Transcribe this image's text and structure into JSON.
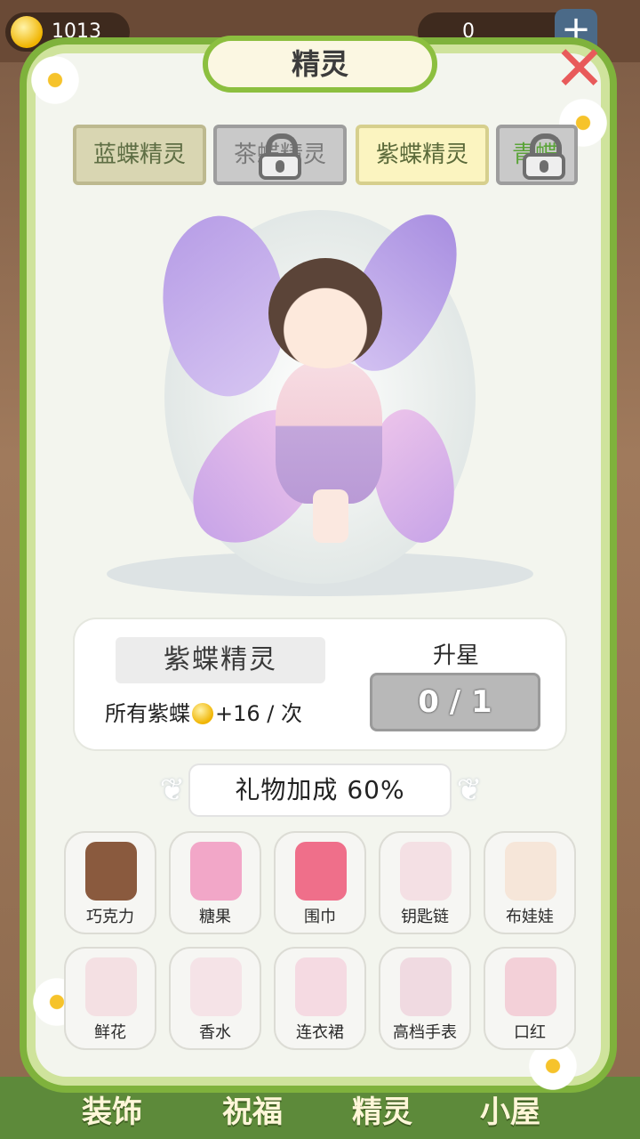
{
  "hud": {
    "currency_left": "1013",
    "currency_right": "0",
    "plus_label": "+"
  },
  "panel": {
    "title": "精灵",
    "close_label": "✕"
  },
  "tabs": [
    {
      "label": "蓝蝶精灵",
      "locked": false
    },
    {
      "label": "茶蝶精灵",
      "locked": true
    },
    {
      "label": "紫蝶精灵",
      "locked": false,
      "selected": true
    },
    {
      "label": "青蝶精灵",
      "locked": true
    }
  ],
  "info": {
    "name": "紫蝶精灵",
    "bonus_prefix": "所有紫蝶",
    "bonus_suffix": "+16 / 次",
    "upgrade_label": "升星",
    "upgrade_progress": "0 / 1"
  },
  "gift_bonus": "礼物加成 60%",
  "gifts": [
    {
      "label": "巧克力",
      "icon": "chocolate-icon",
      "owned": true,
      "color": "#8a5a3e"
    },
    {
      "label": "糖果",
      "icon": "candy-jar-icon",
      "owned": true,
      "color": "#f2a7c8"
    },
    {
      "label": "围巾",
      "icon": "scarf-icon",
      "owned": true,
      "color": "#ef6f8a"
    },
    {
      "label": "钥匙链",
      "icon": "keychain-icon",
      "owned": false,
      "color": "#f2b6c8"
    },
    {
      "label": "布娃娃",
      "icon": "doll-icon",
      "owned": false,
      "color": "#f5c8a8"
    },
    {
      "label": "鲜花",
      "icon": "bouquet-icon",
      "owned": false,
      "color": "#f2b8c6"
    },
    {
      "label": "香水",
      "icon": "perfume-icon",
      "owned": false,
      "color": "#f3c0d2"
    },
    {
      "label": "连衣裙",
      "icon": "dress-icon",
      "owned": false,
      "color": "#f3a6c2"
    },
    {
      "label": "高档手表",
      "icon": "watch-icon",
      "owned": false,
      "color": "#e6a6c0"
    },
    {
      "label": "口红",
      "icon": "lipstick-icon",
      "owned": false,
      "color": "#ef8aa6"
    }
  ],
  "bottom_nav": [
    "装饰",
    "祝福",
    "精灵",
    "小屋"
  ]
}
